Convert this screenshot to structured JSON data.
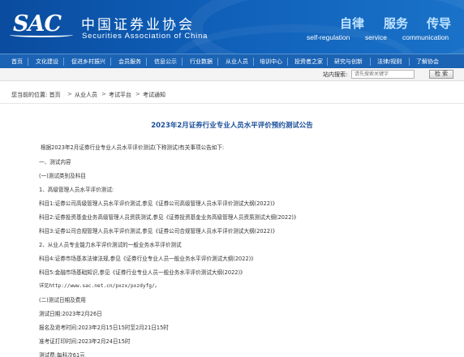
{
  "header": {
    "logo_text": "SAC",
    "org_name_cn": "中国证券业协会",
    "org_name_en": "Securities Association of China",
    "motto_cn": [
      "自律",
      "服务",
      "传导"
    ],
    "motto_en": [
      "self-regulation",
      "service",
      "communication"
    ],
    "colors": {
      "header_blue": "#0f5fb8",
      "motto_light": "#bfe3ff",
      "title_blue": "#1b4f9a"
    }
  },
  "nav": {
    "items": [
      "首页",
      "文化建设",
      "促进乡村振兴",
      "会员服务",
      "信息公示",
      "行业数据",
      "从业人员",
      "培训中心",
      "投资者之家",
      "研究与创新",
      "法律/规则",
      "了解协会"
    ]
  },
  "search": {
    "label": "站内搜索:",
    "placeholder": "请先搜索关键字",
    "button": "检 索"
  },
  "breadcrumb": {
    "items": [
      "您当前的位置: 首页",
      "从业人员",
      "考试平台",
      "考试通知"
    ],
    "separator": ">"
  },
  "article": {
    "title": "2023年2月证券行业专业人员水平评价预约测试公告",
    "paragraphs": [
      "根据2023年2月证券行业专业人员水平评价测试(下称测试)有关事项公告如下:",
      "一、测试内容",
      "(一)测试类别及科目",
      "1、高级管理人员水平评价测试:",
      "科目1:证券公司高级管理人员水平评价测试,参见《证券公司高级管理人员水平评价测试大纲(2022)》",
      "科目2:证券投资基金业务高级管理人员资质测试,参见《证券投资基金业务高级管理人员资质测试大纲(2022)》",
      "科目3:证券公司合规管理人员水平评价测试,参见《证券公司合规管理人员水平评价测试大纲(2022)》",
      "2、从业人员专业能力水平评价测试的一般业务水平评价测试",
      "科目4:证券市场基本法律法规,参见《证券行业专业人员一般业务水平评价测试大纲(2022)》",
      "科目5:金融市场基础知识,参见《证券行业专业人员一般业务水平评价测试大纲(2022)》",
      "详见http://www.sac.net.cn/pxzx/pxzdyfg/。",
      "(二)测试日期及费用",
      "测试日期:2023年2月26日",
      "报名及退考时间:2023年2月15日15时至2月21日15时",
      "准考证打印时间:2023年2月24日15时",
      "测试费:每科次61元"
    ]
  }
}
